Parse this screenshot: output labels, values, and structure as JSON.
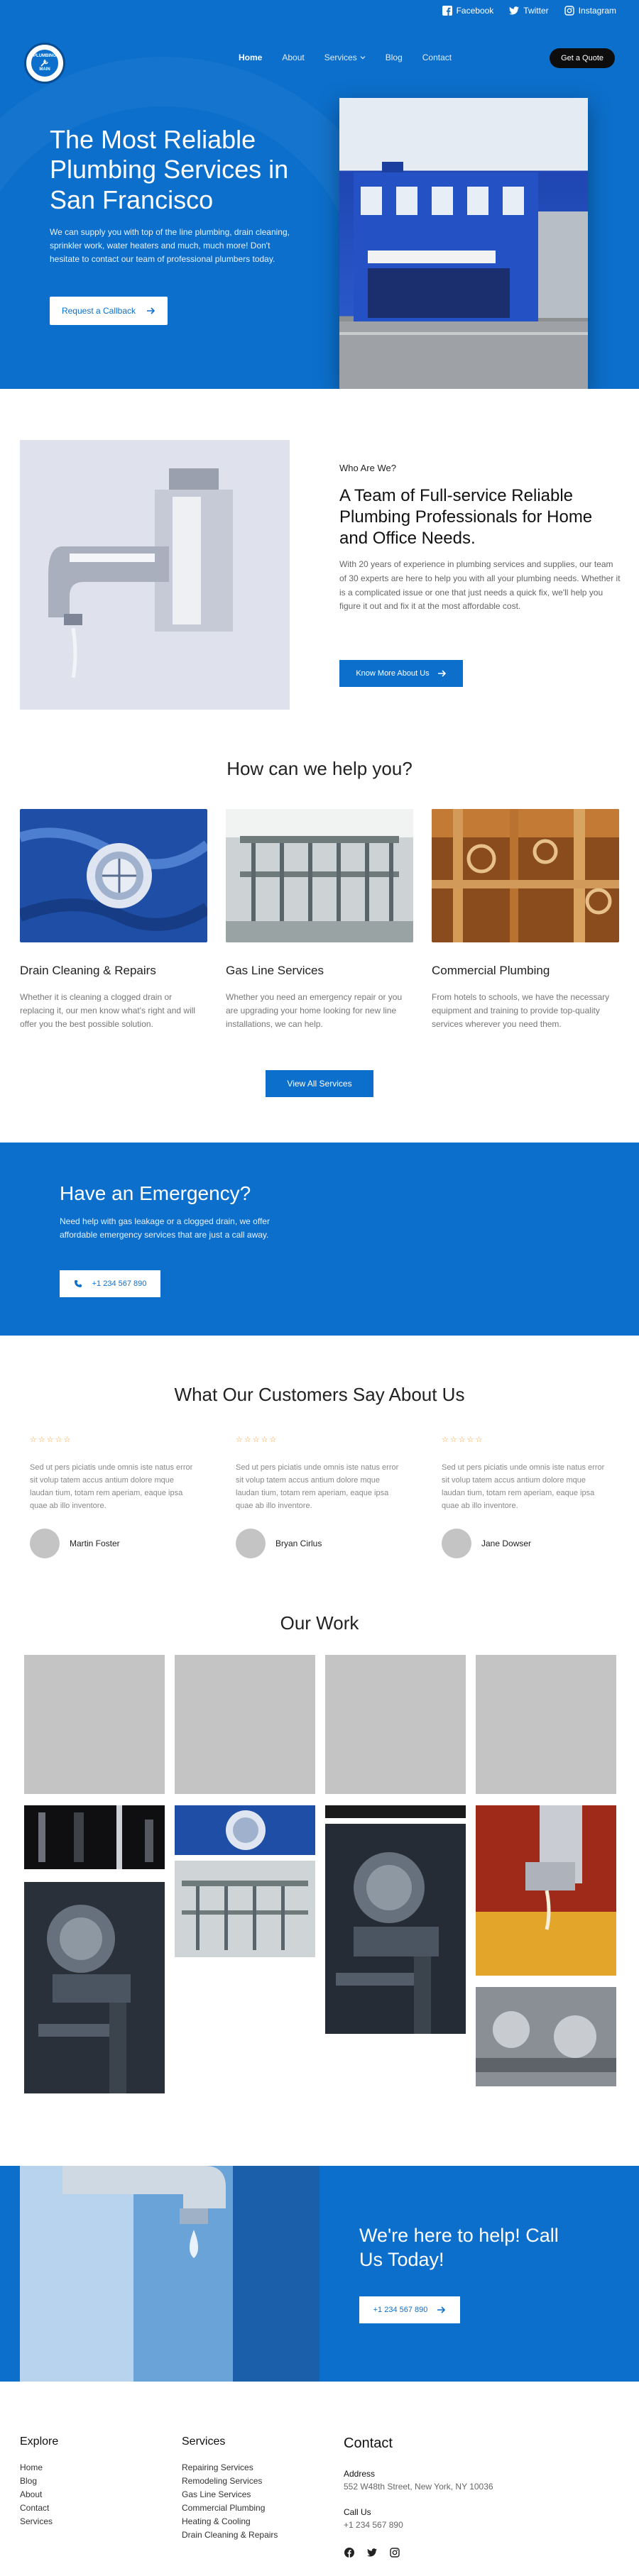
{
  "topbar": {
    "links": [
      {
        "label": "Facebook",
        "icon": "facebook-icon"
      },
      {
        "label": "Twitter",
        "icon": "twitter-icon"
      },
      {
        "label": "Instagram",
        "icon": "instagram-icon"
      }
    ]
  },
  "logo": {
    "line1": "PLUMBING",
    "line2": "MAIN"
  },
  "nav": {
    "items": [
      "Home",
      "About",
      "Services",
      "Blog",
      "Contact"
    ],
    "active": "Home",
    "cta": "Get a Quote"
  },
  "hero": {
    "title": "The Most Reliable Plumbing Services in San Francisco",
    "text": "We can supply you with top of the line plumbing, drain cleaning, sprinkler work, water heaters and much, much more! Don't hesitate to contact our team of professional plumbers today.",
    "button": "Request a Callback"
  },
  "about": {
    "kicker": "Who Are We?",
    "title": "A Team of Full-service Reliable Plumbing Professionals for Home and Office Needs.",
    "text": "With 20 years of experience in plumbing services and supplies, our team of 30 experts are here to help you with all your plumbing needs. Whether it is a complicated issue or one that just needs a quick fix, we'll help you figure it out and fix it at the most affordable cost.",
    "button": "Know More About Us"
  },
  "services": {
    "title": "How can we help you?",
    "items": [
      {
        "title": "Drain Cleaning & Repairs",
        "text": "Whether it is cleaning a clogged drain or replacing it, our men know what's right and will offer you the best possible solution."
      },
      {
        "title": "Gas Line Services",
        "text": "Whether you need an emergency repair or you are upgrading your home looking for new line installations, we can help."
      },
      {
        "title": "Commercial Plumbing",
        "text": "From hotels to schools, we have the necessary equipment and training to provide top-quality services wherever you need them."
      }
    ],
    "button": "View All Services"
  },
  "emergency": {
    "title": "Have an Emergency?",
    "text": "Need help with gas leakage or a clogged drain, we offer affordable emergency services that are just a call away.",
    "phone": "+1 234 567 890"
  },
  "testimonials": {
    "title": "What Our Customers Say About Us",
    "stars": "☆☆☆☆☆",
    "items": [
      {
        "text": "Sed ut pers piciatis unde omnis iste natus error sit volup tatem accus antium dolore mque laudan tium, totam rem aperiam, eaque ipsa quae ab illo inventore.",
        "name": "Martin Foster"
      },
      {
        "text": "Sed ut pers piciatis unde omnis iste natus error sit volup tatem accus antium dolore mque laudan tium, totam rem aperiam, eaque ipsa quae ab illo inventore.",
        "name": "Bryan Cirlus"
      },
      {
        "text": "Sed ut pers piciatis unde omnis iste natus error sit volup tatem accus antium dolore mque laudan tium, totam rem aperiam, eaque ipsa quae ab illo inventore.",
        "name": "Jane Dowser"
      }
    ]
  },
  "work": {
    "title": "Our Work"
  },
  "cta": {
    "title": "We're here to help! Call Us Today!",
    "phone": "+1 234 567 890"
  },
  "footer": {
    "explore": {
      "title": "Explore",
      "links": [
        "Home",
        "Blog",
        "About",
        "Contact",
        "Services"
      ]
    },
    "services": {
      "title": "Services",
      "links": [
        "Repairing Services",
        "Remodeling Services",
        "Gas Line Services",
        "Commercial Plumbing",
        "Heating & Cooling",
        "Drain Cleaning & Repairs"
      ]
    },
    "contact": {
      "title": "Contact",
      "address_label": "Address",
      "address": "552 W48th Street, New York, NY 10036",
      "phone_label": "Call Us",
      "phone": "+1 234 567 890"
    }
  },
  "colors": {
    "brand_blue": "#0c6fcb",
    "dark": "#0d0d0d",
    "star": "#f1a243"
  }
}
